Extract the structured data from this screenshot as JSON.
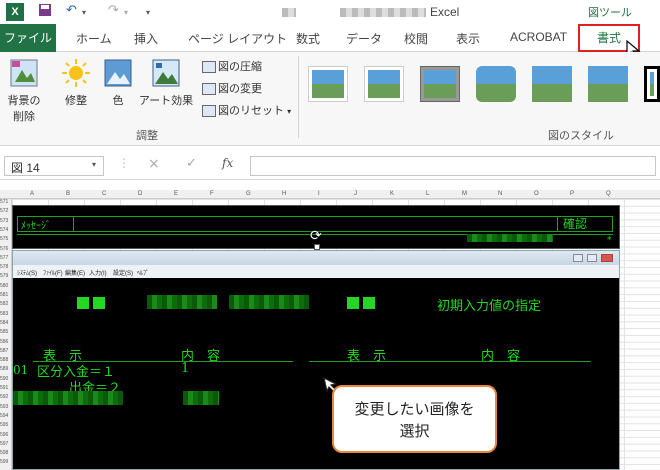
{
  "titlebar": {
    "app_title": "Excel",
    "context_tab_group": "図ツール"
  },
  "tabs": [
    "ファイル",
    "ホーム",
    "挿入",
    "ページ レイアウト",
    "数式",
    "データ",
    "校閲",
    "表示",
    "ACROBAT",
    "書式"
  ],
  "ribbon": {
    "remove_bg_line1": "背景の",
    "remove_bg_line2": "削除",
    "corrections": "修整",
    "color": "色",
    "art_effects": "アート効果",
    "compress": "図の圧縮",
    "change": "図の変更",
    "reset": "図のリセット",
    "group_adjust": "調整",
    "group_styles": "図のスタイル"
  },
  "formula_bar": {
    "name_box": "図 14",
    "fx": "fx",
    "cancel": "×",
    "enter": "✓"
  },
  "columns": [
    "A",
    "B",
    "C",
    "D",
    "E",
    "F",
    "G",
    "H",
    "I",
    "J",
    "K",
    "L",
    "M",
    "N",
    "O",
    "P",
    "Q"
  ],
  "rows": [
    "571",
    "572",
    "573",
    "574",
    "575",
    "576",
    "577",
    "578",
    "579",
    "580",
    "581",
    "582",
    "583",
    "584",
    "585",
    "586",
    "587",
    "588",
    "589",
    "590",
    "591",
    "592",
    "593",
    "594",
    "595",
    "596",
    "597",
    "598",
    "599"
  ],
  "top_image": {
    "message_label": "ﾒｯｾｰｼﾞ",
    "confirm": "確認",
    "asterisk": "*"
  },
  "terminal": {
    "menu_items": [
      "ｼｽﾃﾑ(S)",
      "ﾌｧｲﾙ(F)",
      "編集(E)",
      "入力(I)",
      "設定(S)",
      "ﾍﾙﾌﾟ"
    ],
    "heading": "初期入力値の指定",
    "col_display_1": "表　示",
    "col_content_1": "内　容",
    "col_display_2": "表　示",
    "col_content_2": "内　容",
    "row_num": "01",
    "kubun": "区分入金＝１",
    "shukkin": "出金＝２",
    "val": "1"
  },
  "callout": {
    "line1": "変更したい画像を",
    "line2": "選択"
  },
  "colors": {
    "excel_green": "#217346",
    "terminal_green": "#22d822",
    "highlight_red": "#e02020",
    "callout_border": "#e8883a"
  }
}
